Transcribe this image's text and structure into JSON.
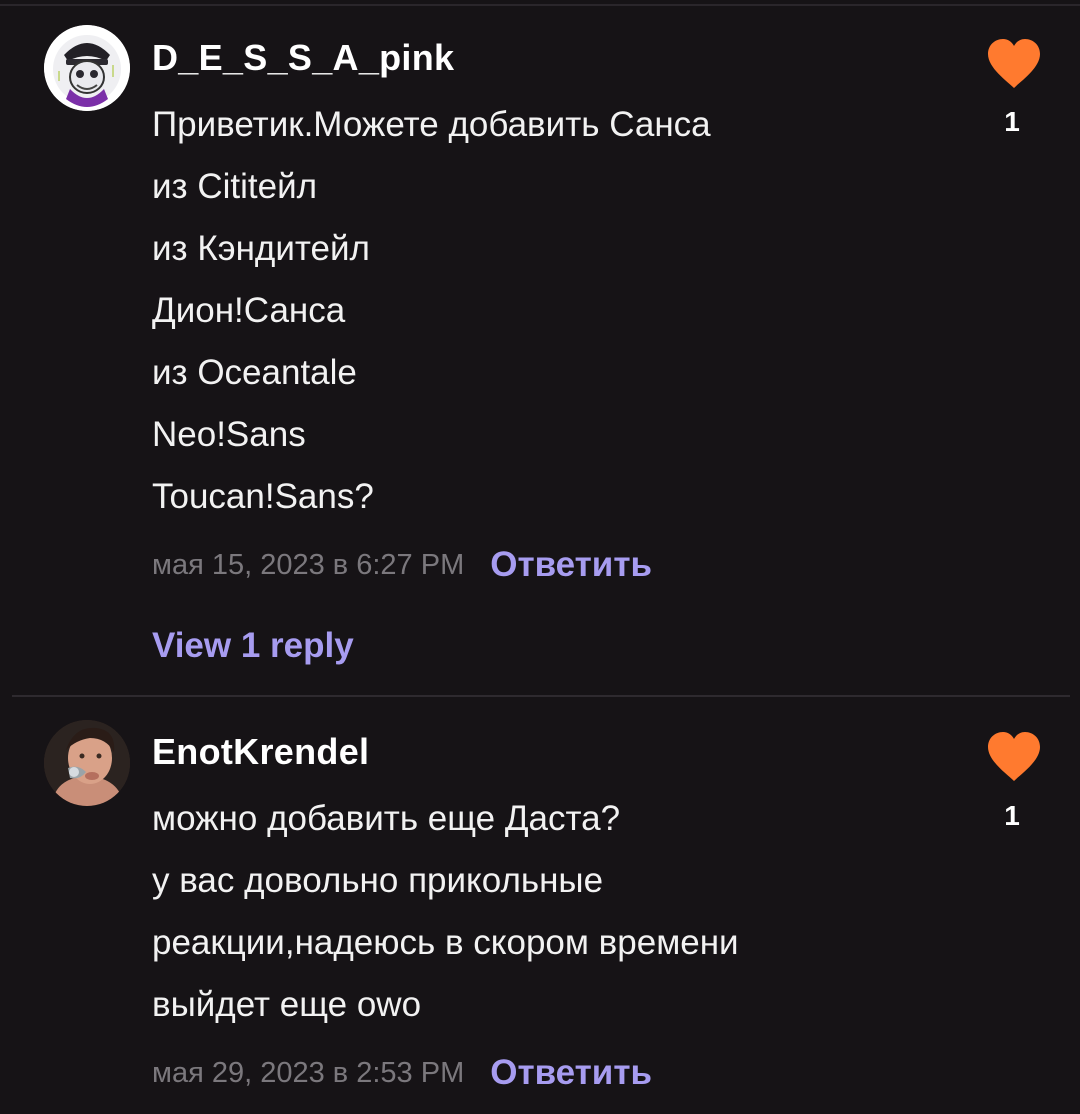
{
  "comments": [
    {
      "username": "D_E_S_S_A_pink",
      "lines": [
        "Приветик.Можете добавить Санса",
        "из Сititейл",
        "из Кэндитейл",
        "Дион!Санса",
        "из Oceantale",
        "Neo!Sans",
        "Toucan!Sans?"
      ],
      "timestamp": "мая 15, 2023 в 6:27 PM",
      "reply_label": "Ответить",
      "view_replies_label": "View 1 reply",
      "like_count": "1"
    },
    {
      "username": "EnotKrendel",
      "lines": [
        "можно добавить еще Даста?",
        "у вас довольно прикольные",
        "реакции,надеюсь в скором времени",
        "выйдет еще owo"
      ],
      "timestamp": "мая 29, 2023 в 2:53 PM",
      "reply_label": "Ответить",
      "like_count": "1"
    }
  ],
  "colors": {
    "background": "#161316",
    "heart": "#ff7a2f",
    "link": "#a79cf0",
    "timestamp": "#7b787d"
  },
  "icons": {
    "like": "heart-icon"
  }
}
